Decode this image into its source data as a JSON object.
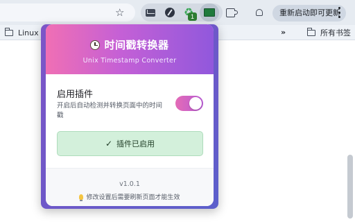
{
  "browser": {
    "update_button_label": "重新启动即可更新",
    "extensions": [
      {
        "icon": "mail-icon"
      },
      {
        "icon": "compass-icon"
      },
      {
        "icon": "recycle-icon",
        "badge": "1"
      },
      {
        "icon": "timestamp-converter-icon",
        "active": true
      },
      {
        "icon": "puzzle-icon"
      }
    ],
    "bookmarks": {
      "left_folder": "Linux",
      "overflow": "»",
      "right_folder": "所有书签"
    }
  },
  "popup": {
    "title": "时间戳转换器",
    "subtitle": "Unix Timestamp Converter",
    "setting": {
      "title": "启用插件",
      "description": "开启后自动检测并转换页面中的时间戳",
      "enabled": true
    },
    "status": {
      "check": "✓",
      "text": "插件已启用"
    },
    "footer": {
      "version": "v1.0.1",
      "tip": "修改设置后需要刷新页面才能生效"
    },
    "colors": {
      "header_gradient_start": "#f06fb4",
      "header_gradient_end": "#9158dc",
      "status_bg": "#d3f0db"
    }
  }
}
